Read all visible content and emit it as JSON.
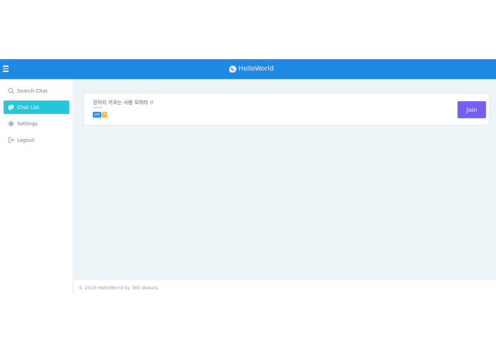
{
  "header": {
    "brand": "HelloWorld",
    "accent_color": "#1e88e5"
  },
  "sidebar": {
    "items": [
      {
        "label": "Search Chat",
        "icon": "search-icon"
      },
      {
        "label": "Chat List",
        "icon": "chat-list-icon",
        "active": true
      },
      {
        "label": "Settings",
        "icon": "gear-icon"
      },
      {
        "label": "Logout",
        "icon": "logout-icon"
      }
    ],
    "active_color": "#26c6da"
  },
  "rooms": [
    {
      "title": "강아지 키우는 사람 모여라 !!",
      "owner": "sunny",
      "tags": [
        {
          "label": "pet",
          "color": "#1e88e5"
        },
        {
          "label": "5",
          "color": "#ffb22b"
        }
      ],
      "join_label": "Join",
      "join_color": "#7460ee"
    }
  ],
  "footer": {
    "text": "© 2018 HelloWorld by 365 dieters"
  }
}
